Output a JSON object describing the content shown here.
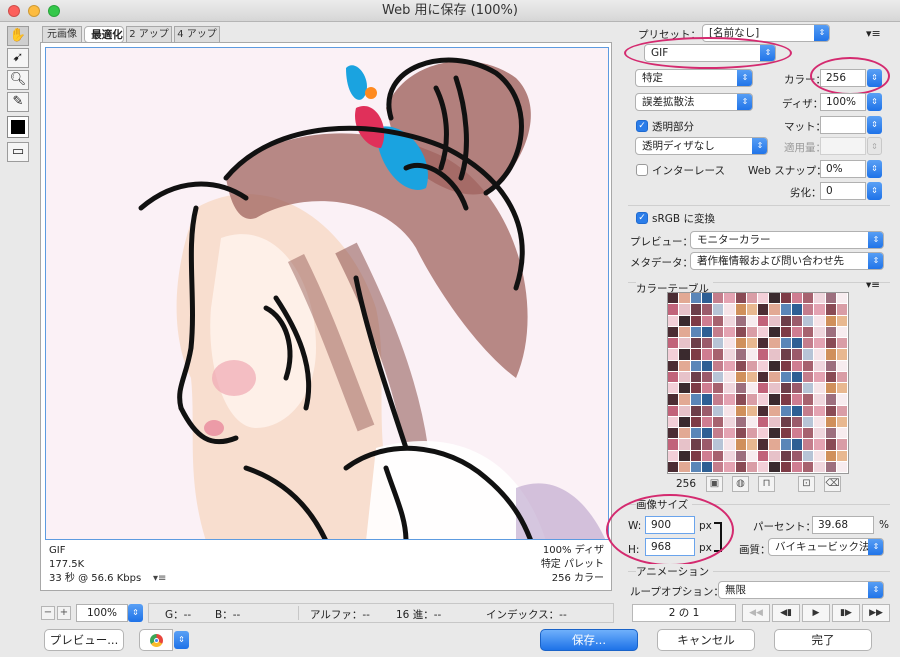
{
  "window": {
    "title": "Web 用に保存 (100%)"
  },
  "tabs": [
    "元画像",
    "最適化",
    "2 アップ",
    "4 アップ"
  ],
  "tools": [
    "hand-tool",
    "slice-select-tool",
    "zoom-tool",
    "eyedropper-tool"
  ],
  "preview_info": {
    "format": "GIF",
    "size": "177.5K",
    "time": "33 秒 @ 56.6 Kbps",
    "dither": "100% ディザ",
    "palette": "特定 パレット",
    "colors": "256 カラー"
  },
  "settings": {
    "preset_label": "プリセット：",
    "preset_value": "[名前なし]",
    "format_value": "GIF",
    "reduction_value": "特定",
    "colors_label": "カラー：",
    "colors_value": "256",
    "dither_method": "誤差拡散法",
    "dither_label": "ディザ：",
    "dither_value": "100%",
    "transparency_label": "透明部分",
    "matte_label": "マット：",
    "matte_value": "",
    "transparency_dither": "透明ディザなし",
    "amount_label": "適用量：",
    "amount_value": "",
    "interlace_label": "インターレース",
    "websnap_label": "Web スナップ：",
    "websnap_value": "0%",
    "lossy_label": "劣化：",
    "lossy_value": "0",
    "srgb_label": "sRGB に変換",
    "preview_label": "プレビュー：",
    "preview_value": "モニターカラー",
    "metadata_label": "メタデータ：",
    "metadata_value": "著作権情報および問い合わせ先"
  },
  "color_table": {
    "title": "カラーテーブル",
    "count": "256",
    "swatches": [
      "#c47d8c",
      "#e4a3b2",
      "#6d3f4a",
      "#9b5b6b",
      "#f3cfd8",
      "#3a2a2e",
      "#d0905b",
      "#e8b890",
      "#a7626f",
      "#f0d7de",
      "#5a86b8",
      "#2e5f94",
      "#c1637a",
      "#e7c2c9",
      "#8a4b55",
      "#d99da6",
      "#b7c4d6",
      "#f6e4e8",
      "#7e3b46",
      "#cf7d91",
      "#4b2c33",
      "#e2a994",
      "#9d6f7e",
      "#f7ecef"
    ]
  },
  "image_size": {
    "title": "画像サイズ",
    "w_label": "W:",
    "w_value": "900",
    "h_label": "H:",
    "h_value": "968",
    "unit": "px",
    "percent_label": "パーセント：",
    "percent_value": "39.68",
    "percent_unit": "%",
    "quality_label": "画質：",
    "quality_value": "バイキュービック法"
  },
  "animation": {
    "title": "アニメーション",
    "loop_label": "ループオプション：",
    "loop_value": "無限",
    "frame": "2 の 1"
  },
  "statusbar": {
    "zoom": "100%",
    "g": "G：--",
    "b": "B：--",
    "alpha": "アルファ：--",
    "hex": "16 進：--",
    "index": "インデックス：--"
  },
  "buttons": {
    "preview": "プレビュー...",
    "save": "保存...",
    "cancel": "キャンセル",
    "done": "完了"
  },
  "colors": {
    "accent": "#1e72e8",
    "highlight": "#d42a6f"
  }
}
